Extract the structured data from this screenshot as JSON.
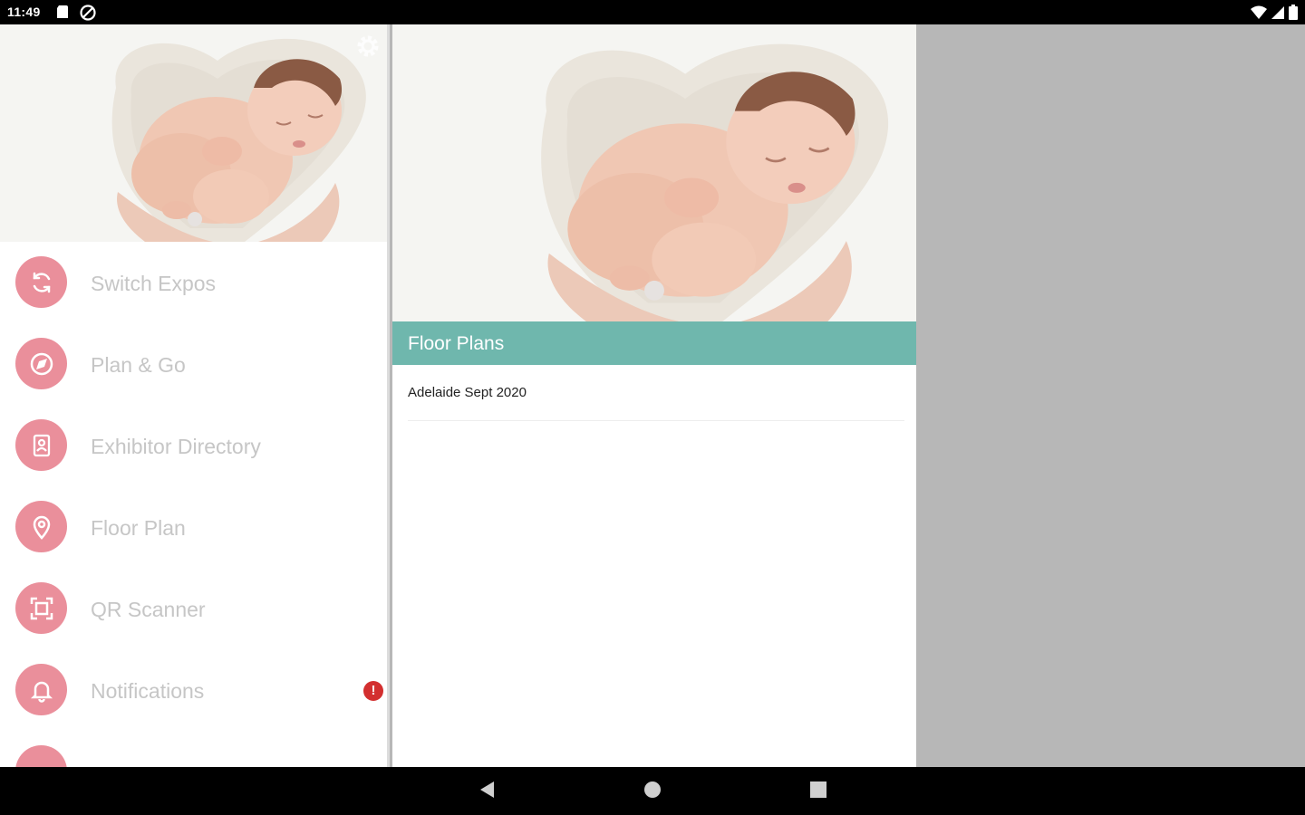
{
  "status_bar": {
    "time": "11:49",
    "left_icons": [
      "sd-card-icon",
      "block-icon"
    ],
    "right_icons": [
      "wifi-icon",
      "cellular-signal-icon",
      "battery-icon"
    ]
  },
  "drawer": {
    "header_image": "sleeping-newborn-baby-photo",
    "settings_icon": "gear-icon",
    "items": [
      {
        "label": "Switch Expos",
        "icon": "refresh-icon"
      },
      {
        "label": "Plan & Go",
        "icon": "compass-icon"
      },
      {
        "label": "Exhibitor Directory",
        "icon": "contact-book-icon"
      },
      {
        "label": "Floor Plan",
        "icon": "map-pin-icon"
      },
      {
        "label": "QR Scanner",
        "icon": "qr-scan-icon"
      },
      {
        "label": "Notifications",
        "icon": "bell-icon",
        "badge": "!"
      }
    ],
    "accent_color": "#ea8f9b"
  },
  "main": {
    "hero_image": "sleeping-newborn-baby-photo",
    "section_title": "Floor Plans",
    "section_color": "#6fb7ad",
    "plans": [
      "Adelaide Sept 2020"
    ]
  },
  "nav_bar": {
    "buttons": [
      "back-triangle-icon",
      "home-circle-icon",
      "recents-square-icon"
    ]
  }
}
